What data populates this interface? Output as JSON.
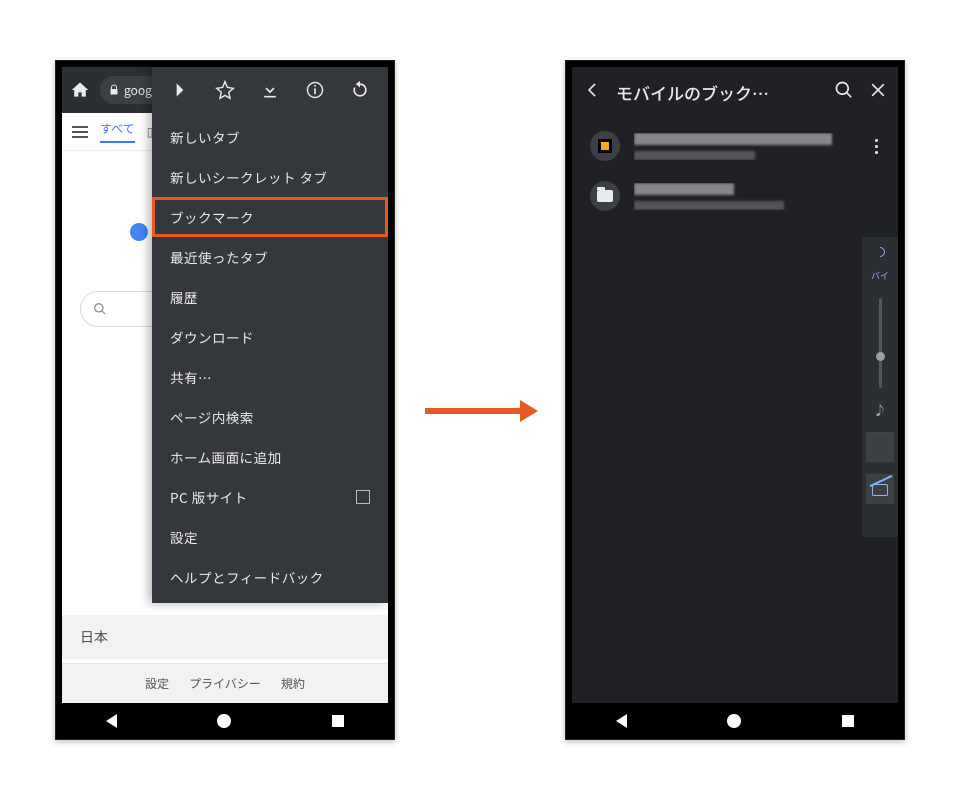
{
  "left": {
    "url_text": "google",
    "tabs": {
      "active": "すべて"
    },
    "menu_items": [
      "新しいタブ",
      "新しいシークレット タブ",
      "ブックマーク",
      "最近使ったタブ",
      "履歴",
      "ダウンロード",
      "共有…",
      "ページ内検索",
      "ホーム画面に追加",
      "PC 版サイト",
      "設定",
      "ヘルプとフィードバック"
    ],
    "highlight_index": 2,
    "checkbox_index": 9,
    "footer_country": "日本",
    "footer_links": [
      "設定",
      "プライバシー",
      "規約"
    ]
  },
  "right": {
    "header_title": "モバイルのブック…",
    "side_label": "バイ"
  }
}
